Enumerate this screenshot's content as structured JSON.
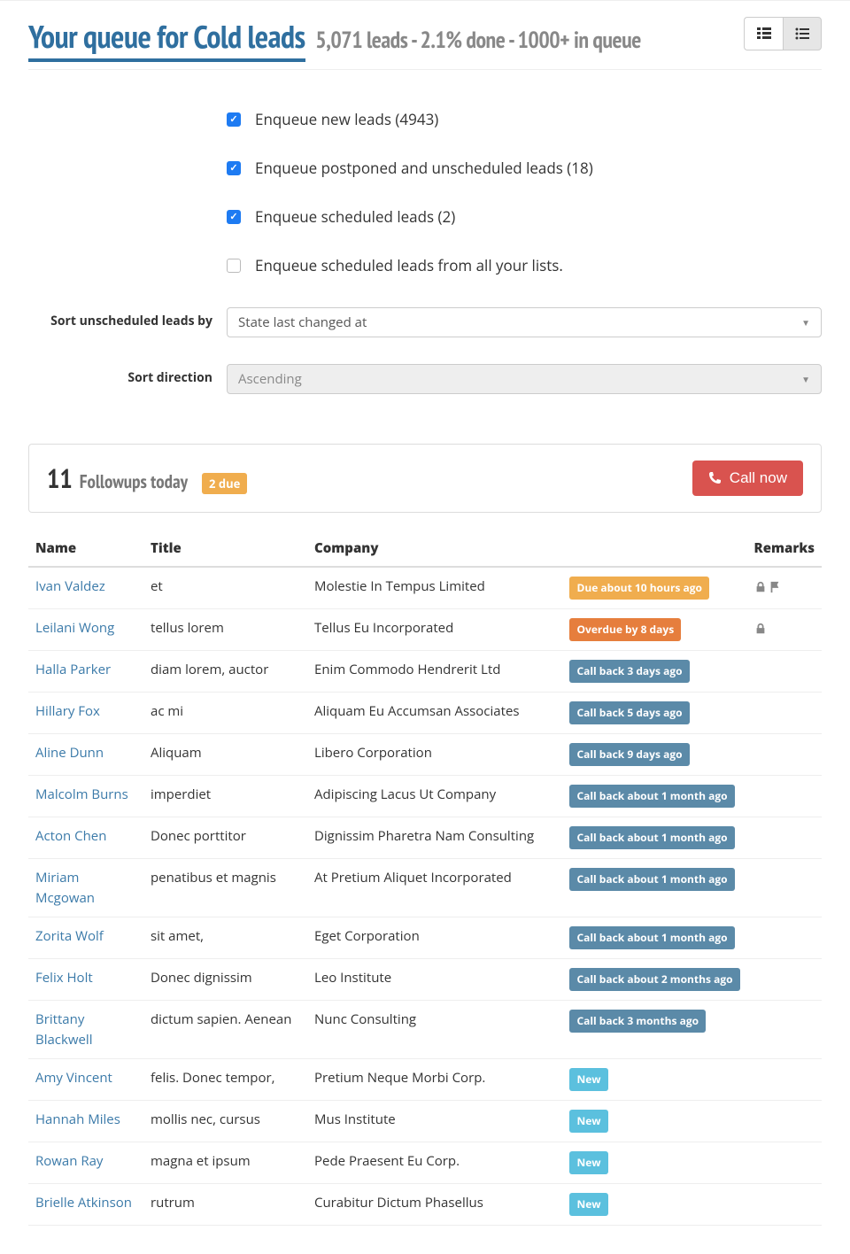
{
  "header": {
    "title": "Your queue for Cold leads",
    "subtitle": "5,071 leads - 2.1% done - 1000+ in queue"
  },
  "view": {
    "grid_active": false,
    "list_active": true
  },
  "filters": {
    "checkboxes": [
      {
        "label": "Enqueue new leads (4943)",
        "checked": true
      },
      {
        "label": "Enqueue postponed and unscheduled leads (18)",
        "checked": true
      },
      {
        "label": "Enqueue scheduled leads (2)",
        "checked": true
      },
      {
        "label": "Enqueue scheduled leads from all your lists.",
        "checked": false
      }
    ],
    "sort_unscheduled": {
      "label": "Sort unscheduled leads by",
      "value": "State last changed at"
    },
    "sort_direction": {
      "label": "Sort direction",
      "value": "Ascending",
      "disabled": true
    }
  },
  "followups": {
    "count": "11",
    "text": "Followups today",
    "due_badge": "2 due",
    "call_button": "Call now"
  },
  "table": {
    "headers": [
      "Name",
      "Title",
      "Company",
      "",
      "Remarks"
    ],
    "rows": [
      {
        "name": "Ivan Valdez",
        "title": "et",
        "company": "Molestie In Tempus Limited",
        "status": "Due about 10 hours ago",
        "status_class": "warn",
        "remarks": [
          "lock",
          "flag"
        ]
      },
      {
        "name": "Leilani Wong",
        "title": "tellus lorem",
        "company": "Tellus Eu Incorporated",
        "status": "Overdue by 8 days",
        "status_class": "danger",
        "remarks": [
          "lock"
        ]
      },
      {
        "name": "Halla Parker",
        "title": "diam lorem, auctor",
        "company": "Enim Commodo Hendrerit Ltd",
        "status": "Call back 3 days ago",
        "status_class": "info",
        "remarks": []
      },
      {
        "name": "Hillary Fox",
        "title": "ac mi",
        "company": "Aliquam Eu Accumsan Associates",
        "status": "Call back 5 days ago",
        "status_class": "info",
        "remarks": []
      },
      {
        "name": "Aline Dunn",
        "title": "Aliquam",
        "company": "Libero Corporation",
        "status": "Call back 9 days ago",
        "status_class": "info",
        "remarks": []
      },
      {
        "name": "Malcolm Burns",
        "title": "imperdiet",
        "company": "Adipiscing Lacus Ut Company",
        "status": "Call back about 1 month ago",
        "status_class": "info",
        "remarks": []
      },
      {
        "name": "Acton Chen",
        "title": "Donec porttitor",
        "company": "Dignissim Pharetra Nam Consulting",
        "status": "Call back about 1 month ago",
        "status_class": "info",
        "remarks": []
      },
      {
        "name": "Miriam Mcgowan",
        "title": "penatibus et magnis",
        "company": "At Pretium Aliquet Incorporated",
        "status": "Call back about 1 month ago",
        "status_class": "info",
        "remarks": []
      },
      {
        "name": "Zorita Wolf",
        "title": "sit amet,",
        "company": "Eget Corporation",
        "status": "Call back about 1 month ago",
        "status_class": "info",
        "remarks": []
      },
      {
        "name": "Felix Holt",
        "title": "Donec dignissim",
        "company": "Leo Institute",
        "status": "Call back about 2 months ago",
        "status_class": "info",
        "remarks": []
      },
      {
        "name": "Brittany Blackwell",
        "title": "dictum sapien. Aenean",
        "company": "Nunc Consulting",
        "status": "Call back 3 months ago",
        "status_class": "info",
        "remarks": []
      },
      {
        "name": "Amy Vincent",
        "title": "felis. Donec tempor,",
        "company": "Pretium Neque Morbi Corp.",
        "status": "New",
        "status_class": "new",
        "remarks": []
      },
      {
        "name": "Hannah Miles",
        "title": "mollis nec, cursus",
        "company": "Mus Institute",
        "status": "New",
        "status_class": "new",
        "remarks": []
      },
      {
        "name": "Rowan Ray",
        "title": "magna et ipsum",
        "company": "Pede Praesent Eu Corp.",
        "status": "New",
        "status_class": "new",
        "remarks": []
      },
      {
        "name": "Brielle Atkinson",
        "title": "rutrum",
        "company": "Curabitur Dictum Phasellus",
        "status": "New",
        "status_class": "new",
        "remarks": []
      }
    ]
  }
}
